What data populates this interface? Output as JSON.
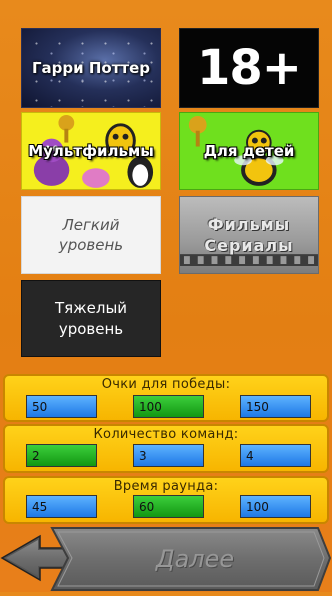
{
  "categories": [
    {
      "label": "Гарри Поттер"
    },
    {
      "label": "18+"
    },
    {
      "label": "Мультфильмы"
    },
    {
      "label": "Для детей"
    },
    {
      "line1": "Легкий",
      "line2": "уровень"
    },
    {
      "line1": "Фильмы",
      "line2": "Сериалы"
    },
    {
      "line1": "Тяжелый",
      "line2": "уровень"
    }
  ],
  "settings": {
    "win_points": {
      "title": "Очки для победы:",
      "options": [
        "50",
        "100",
        "150"
      ],
      "selected": "100"
    },
    "teams": {
      "title": "Количество команд:",
      "options": [
        "2",
        "3",
        "4"
      ],
      "selected": "2"
    },
    "round_time": {
      "title": "Время раунда:",
      "options": [
        "45",
        "60",
        "100"
      ],
      "selected": "60"
    }
  },
  "navigation": {
    "back_icon": "left-arrow-icon",
    "next_label": "Далее"
  },
  "colors": {
    "background": "#e88a1c",
    "panel": "#ffd21a",
    "option_blue": "#1e78e6",
    "option_selected": "#129712"
  }
}
